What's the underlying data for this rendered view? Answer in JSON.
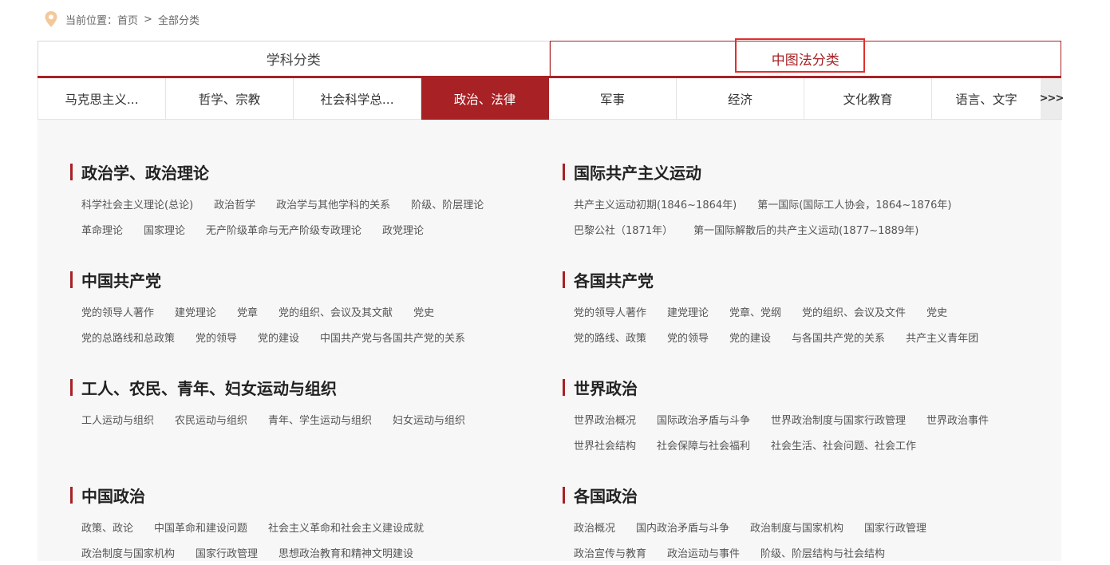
{
  "breadcrumb": {
    "prefix": "当前位置：",
    "home": "首页",
    "separator": ">",
    "current": "全部分类"
  },
  "top_tabs": [
    {
      "label": "学科分类"
    },
    {
      "label": "中图法分类"
    }
  ],
  "sub_tabs": [
    {
      "label": "马克思主义..."
    },
    {
      "label": "哲学、宗教"
    },
    {
      "label": "社会科学总..."
    },
    {
      "label": "政治、法律"
    },
    {
      "label": "军事"
    },
    {
      "label": "经济"
    },
    {
      "label": "文化教育"
    },
    {
      "label": "语言、文字"
    }
  ],
  "more_label": ">>>",
  "sections": [
    {
      "title": "政治学、政治理论",
      "rows": [
        [
          "科学社会主义理论(总论)",
          "政治哲学",
          "政治学与其他学科的关系",
          "阶级、阶层理论"
        ],
        [
          "革命理论",
          "国家理论",
          "无产阶级革命与无产阶级专政理论",
          "政党理论"
        ]
      ]
    },
    {
      "title": "国际共产主义运动",
      "rows": [
        [
          "共产主义运动初期(1846~1864年)",
          "第一国际(国际工人协会，1864~1876年)"
        ],
        [
          "巴黎公社（1871年）",
          "第一国际解散后的共产主义运动(1877~1889年)"
        ]
      ]
    },
    {
      "title": "中国共产党",
      "rows": [
        [
          "党的领导人著作",
          "建党理论",
          "党章",
          "党的组织、会议及其文献",
          "党史"
        ],
        [
          "党的总路线和总政策",
          "党的领导",
          "党的建设",
          "中国共产党与各国共产党的关系"
        ]
      ]
    },
    {
      "title": "各国共产党",
      "rows": [
        [
          "党的领导人著作",
          "建党理论",
          "党章、党纲",
          "党的组织、会议及文件",
          "党史"
        ],
        [
          "党的路线、政策",
          "党的领导",
          "党的建设",
          "与各国共产党的关系",
          "共产主义青年团"
        ]
      ]
    },
    {
      "title": "工人、农民、青年、妇女运动与组织",
      "rows": [
        [
          "工人运动与组织",
          "农民运动与组织",
          "青年、学生运动与组织",
          "妇女运动与组织"
        ]
      ]
    },
    {
      "title": "世界政治",
      "rows": [
        [
          "世界政治概况",
          "国际政治矛盾与斗争",
          "世界政治制度与国家行政管理",
          "世界政治事件"
        ],
        [
          "世界社会结构",
          "社会保障与社会福利",
          "社会生活、社会问题、社会工作"
        ]
      ]
    },
    {
      "title": "中国政治",
      "rows": [
        [
          "政策、政论",
          "中国革命和建设问题",
          "社会主义革命和社会主义建设成就"
        ],
        [
          "政治制度与国家机构",
          "国家行政管理",
          "思想政治教育和精神文明建设"
        ]
      ]
    },
    {
      "title": "各国政治",
      "rows": [
        [
          "政治概况",
          "国内政治矛盾与斗争",
          "政治制度与国家机构",
          "国家行政管理"
        ],
        [
          "政治宣传与教育",
          "政治运动与事件",
          "阶级、阶层结构与社会结构"
        ]
      ]
    }
  ],
  "colors": {
    "accent": "#a82125",
    "highlight_box": "#e0302c",
    "pin_icon": "#f5c89a"
  }
}
